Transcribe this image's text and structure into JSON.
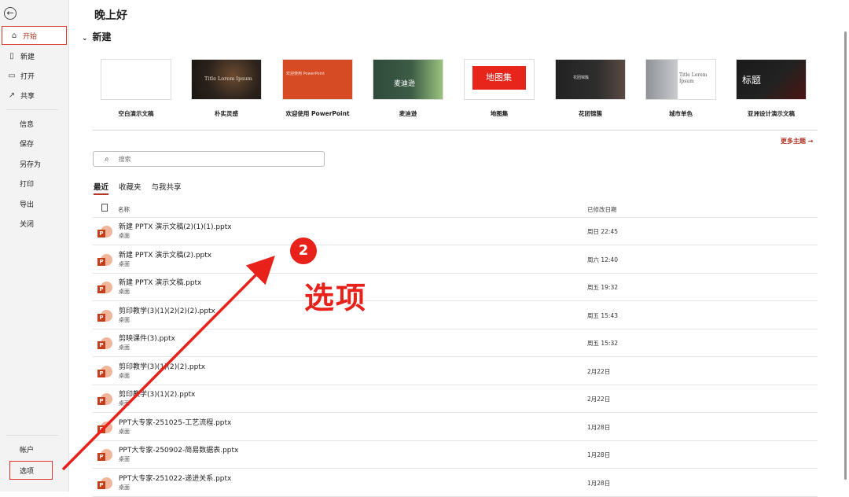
{
  "sidebar": {
    "back_icon": "arrow-left-icon",
    "top_items": [
      {
        "label": "开始",
        "icon": "home-icon"
      },
      {
        "label": "新建",
        "icon": "new-file-icon"
      },
      {
        "label": "打开",
        "icon": "folder-open-icon"
      },
      {
        "label": "共享",
        "icon": "share-icon"
      }
    ],
    "mid_items": [
      "信息",
      "保存",
      "另存为",
      "打印",
      "导出",
      "关闭"
    ],
    "bottom_items": [
      "帐户",
      "选项"
    ]
  },
  "main": {
    "greeting": "晚上好",
    "new_heading": "新建",
    "templates": [
      {
        "label": "空白演示文稿",
        "thumb_text": ""
      },
      {
        "label": "朴实灵感",
        "thumb_text": "Title Lorem Ipsum"
      },
      {
        "label": "欢迎使用 PowerPoint",
        "thumb_text": "欢迎使用 PowerPoint"
      },
      {
        "label": "麦迪逊",
        "thumb_text": "麦迪逊"
      },
      {
        "label": "地图集",
        "thumb_text": "地图集"
      },
      {
        "label": "花团锦簇",
        "thumb_text": "花团锦簇"
      },
      {
        "label": "城市单色",
        "thumb_text": "Title Lorem Ipsum"
      },
      {
        "label": "亚洲设计演示文稿",
        "thumb_text": "标题"
      }
    ],
    "more_themes": "更多主题 →",
    "search_placeholder": "搜索",
    "tabs": [
      "最近",
      "收藏夹",
      "与我共享"
    ],
    "columns": {
      "name": "名称",
      "modified": "已修改日期"
    },
    "files": [
      {
        "name": "新建 PPTX 演示文稿(2)(1)(1).pptx",
        "location": "桌面",
        "date": "周日 22:45"
      },
      {
        "name": "新建 PPTX 演示文稿(2).pptx",
        "location": "桌面",
        "date": "周六 12:40"
      },
      {
        "name": "新建 PPTX 演示文稿.pptx",
        "location": "桌面",
        "date": "周五 19:32"
      },
      {
        "name": "剪印教学(3)(1)(2)(2)(2).pptx",
        "location": "桌面",
        "date": "周五 15:43"
      },
      {
        "name": "剪映课件(3).pptx",
        "location": "桌面",
        "date": "周五 15:32"
      },
      {
        "name": "剪印教学(3)(1)(2)(2).pptx",
        "location": "桌面",
        "date": "2月22日"
      },
      {
        "name": "剪印教学(3)(1)(2).pptx",
        "location": "桌面",
        "date": "2月22日"
      },
      {
        "name": "PPT大专家-251025-工艺流程.pptx",
        "location": "桌面",
        "date": "1月28日"
      },
      {
        "name": "PPT大专家-250902-简易数据表.pptx",
        "location": "桌面",
        "date": "1月28日"
      },
      {
        "name": "PPT大专家-251022-递进关系.pptx",
        "location": "桌面",
        "date": "1月28日"
      }
    ]
  },
  "annotation": {
    "step": "2",
    "text": "选项",
    "color": "#e8221b"
  }
}
